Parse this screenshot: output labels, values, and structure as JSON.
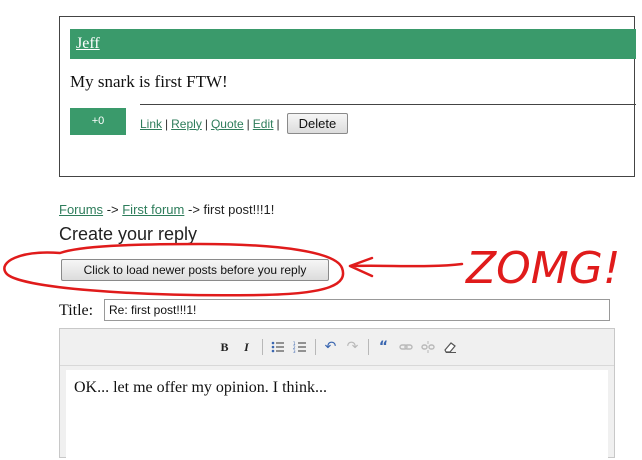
{
  "post": {
    "author": "Jeff",
    "body": "My snark is first FTW!",
    "vote": "+0",
    "actions": [
      "Link",
      "Reply",
      "Quote",
      "Edit"
    ],
    "delete_label": "Delete"
  },
  "breadcrumb": {
    "forums": "Forums",
    "sep1": "->",
    "first_forum": "First forum",
    "sep2": "->",
    "current": "first post!!!1!"
  },
  "page_heading": "Create your reply",
  "load_button": "Click to load newer posts before you reply",
  "annotation_text": "ZOMG!",
  "annotation_color": "#e01b1b",
  "form": {
    "title_label": "Title:",
    "title_value": "Re: first post!!!1!"
  },
  "toolbar": {
    "bold": "B",
    "italic": "I",
    "icons": [
      "bold-icon",
      "italic-icon",
      "bullet-list-icon",
      "numbered-list-icon",
      "undo-icon",
      "redo-icon",
      "quote-icon",
      "link-icon",
      "unlink-icon",
      "eraser-icon"
    ]
  },
  "editor": {
    "text": "OK... let me offer my opinion. I think..."
  },
  "colors": {
    "brand_green": "#3a9a6b",
    "link_green": "#2e7d5b"
  }
}
